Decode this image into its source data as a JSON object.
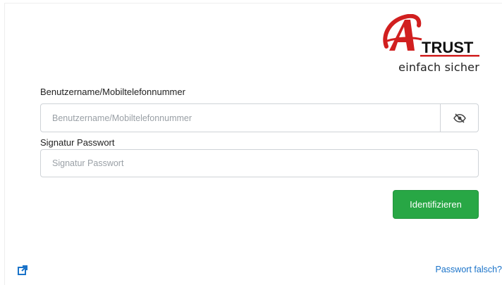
{
  "logo": {
    "brand_letter": "A",
    "brand_word": "TRUST",
    "tagline": "einfach sicher",
    "accent_color": "#d11f1f"
  },
  "form": {
    "username_label": "Benutzername/Mobiltelefonnummer",
    "username_placeholder": "Benutzername/Mobiltelefonnummer",
    "username_value": "",
    "toggle_icon": "eye-slash-icon",
    "password_label": "Signatur Passwort",
    "password_placeholder": "Signatur Passwort",
    "password_value": "",
    "submit_label": "Identifizieren",
    "submit_color": "#28a745"
  },
  "footer": {
    "external_icon": "external-link-icon",
    "forgot_link": "Passwort falsch?",
    "link_color": "#1a73c9"
  }
}
